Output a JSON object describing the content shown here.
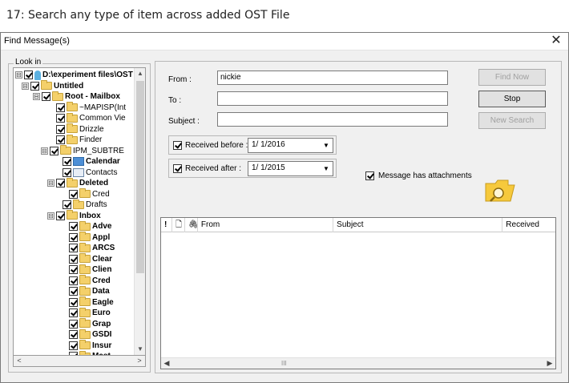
{
  "caption": "17: Search any type of item across added OST File",
  "window": {
    "title": "Find Message(s)",
    "close_glyph": "✕"
  },
  "look_in": {
    "label": "Look in",
    "items": [
      {
        "label": "D:\\experiment files\\OST",
        "icon": "pin",
        "expander": "⊟",
        "bold": true
      },
      {
        "label": "Untitled",
        "icon": "folder",
        "expander": "⊟",
        "bold": true
      },
      {
        "label": "Root - Mailbox",
        "icon": "folder",
        "expander": "⊟",
        "bold": true
      },
      {
        "label": "~MAPISP(Int",
        "icon": "folder",
        "expander": "",
        "bold": false
      },
      {
        "label": "Common Vie",
        "icon": "folder",
        "expander": "",
        "bold": false
      },
      {
        "label": "Drizzle",
        "icon": "folder",
        "expander": "",
        "bold": false
      },
      {
        "label": "Finder",
        "icon": "folder",
        "expander": "",
        "bold": false
      },
      {
        "label": "IPM_SUBTRE",
        "icon": "folder",
        "expander": "⊟",
        "bold": false
      },
      {
        "label": "Calendar",
        "icon": "calendar",
        "expander": "",
        "bold": true
      },
      {
        "label": "Contacts",
        "icon": "contact",
        "expander": "",
        "bold": false
      },
      {
        "label": "Deleted",
        "icon": "folder",
        "expander": "⊟",
        "bold": true
      },
      {
        "label": "Cred",
        "icon": "folder",
        "expander": "",
        "bold": false
      },
      {
        "label": "Drafts",
        "icon": "folder",
        "expander": "",
        "bold": false
      },
      {
        "label": "Inbox",
        "icon": "folder",
        "expander": "⊟",
        "bold": true
      },
      {
        "label": "Adve",
        "icon": "folder",
        "expander": "",
        "bold": true
      },
      {
        "label": "Appl",
        "icon": "folder",
        "expander": "",
        "bold": true
      },
      {
        "label": "ARCS",
        "icon": "folder",
        "expander": "",
        "bold": true
      },
      {
        "label": "Clear",
        "icon": "folder",
        "expander": "",
        "bold": true
      },
      {
        "label": "Clien",
        "icon": "folder",
        "expander": "",
        "bold": true
      },
      {
        "label": "Cred",
        "icon": "folder",
        "expander": "",
        "bold": true
      },
      {
        "label": "Data",
        "icon": "folder",
        "expander": "",
        "bold": true
      },
      {
        "label": "Eagle",
        "icon": "folder",
        "expander": "",
        "bold": true
      },
      {
        "label": "Euro",
        "icon": "folder",
        "expander": "",
        "bold": true
      },
      {
        "label": "Grap",
        "icon": "folder",
        "expander": "",
        "bold": true
      },
      {
        "label": "GSDI",
        "icon": "folder",
        "expander": "",
        "bold": true
      },
      {
        "label": "Insur",
        "icon": "folder",
        "expander": "",
        "bold": true
      },
      {
        "label": "Mast",
        "icon": "folder",
        "expander": "",
        "bold": true
      }
    ]
  },
  "form": {
    "from_label": "From :",
    "from_value": "nickie",
    "to_label": "To :",
    "to_value": "",
    "subject_label": "Subject :",
    "subject_value": "",
    "received_before_label": "Received before :",
    "received_before_value": "1/ 1/2016",
    "received_after_label": "Received after :",
    "received_after_value": "1/ 1/2015",
    "attachments_label": "Message has attachments"
  },
  "buttons": {
    "find_now": "Find Now",
    "stop": "Stop",
    "new_search": "New Search"
  },
  "results": {
    "columns": [
      "!",
      "",
      "",
      "From",
      "Subject",
      "Received"
    ],
    "scroll_grip": "III"
  }
}
